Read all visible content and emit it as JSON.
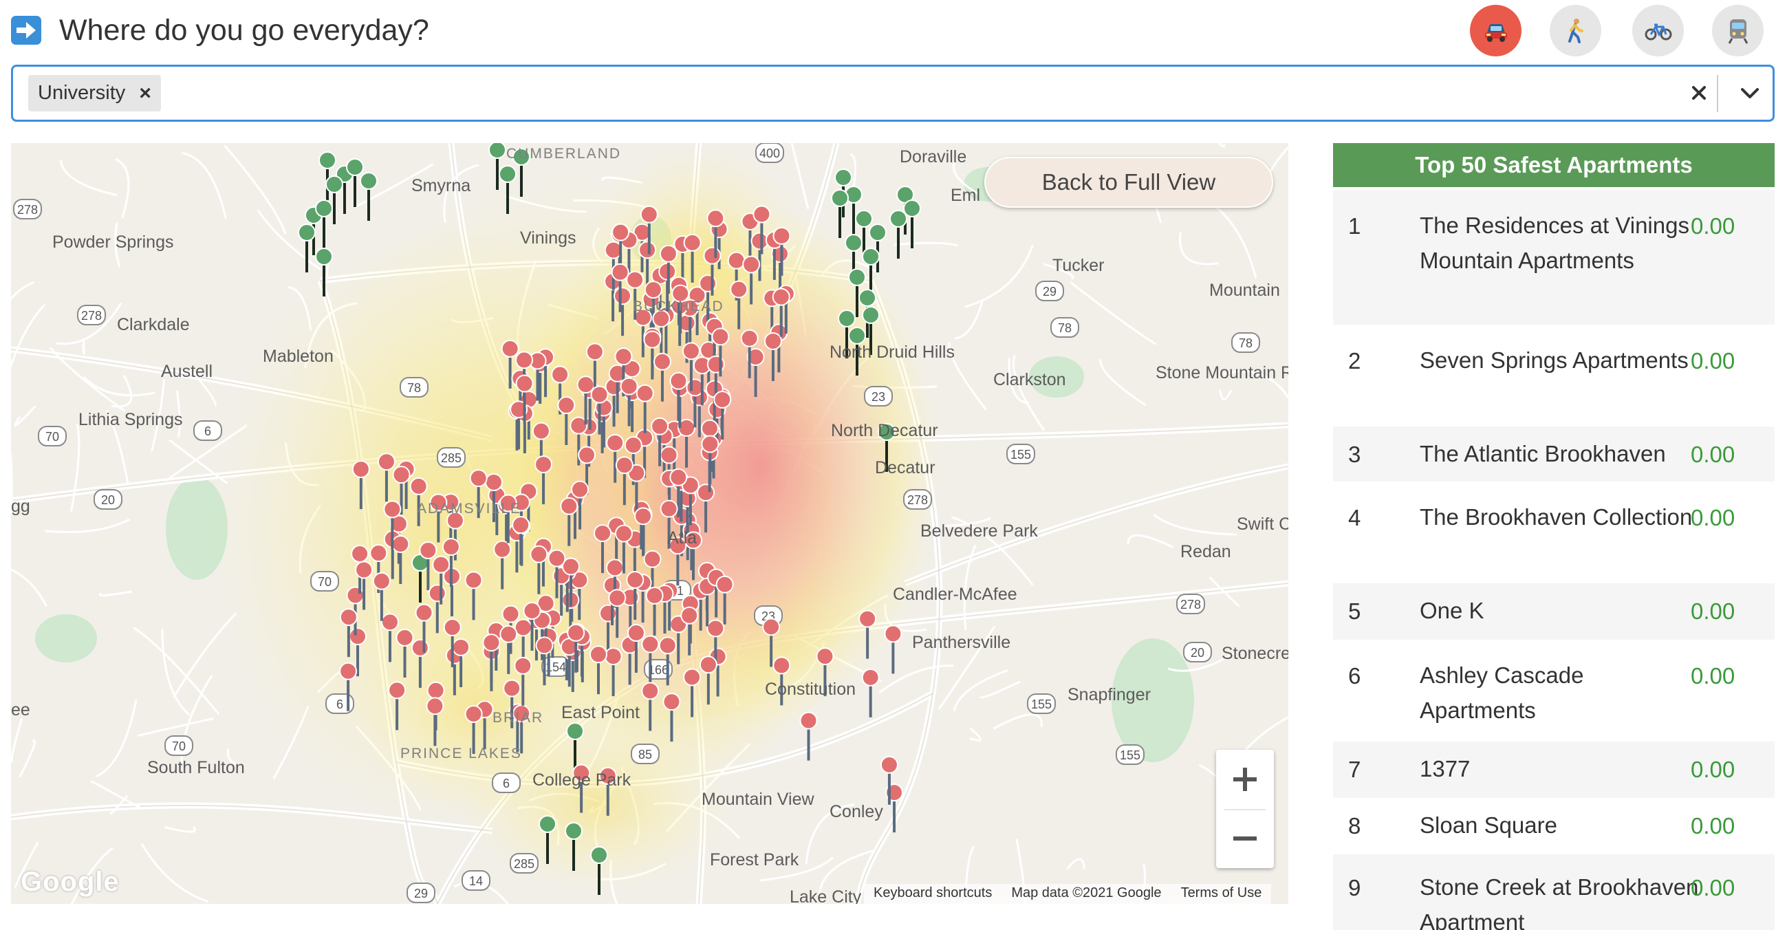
{
  "header": {
    "question": "Where do you go everyday?",
    "modes": [
      {
        "name": "car",
        "icon": "car-icon",
        "active": true
      },
      {
        "name": "walk",
        "icon": "walking-person-icon",
        "active": false
      },
      {
        "name": "bike",
        "icon": "bicycle-icon",
        "active": false
      },
      {
        "name": "transit",
        "icon": "train-icon",
        "active": false
      }
    ]
  },
  "select": {
    "selected": [
      "University"
    ]
  },
  "map": {
    "back_button": "Back to Full View",
    "google": "Google",
    "attribution": {
      "shortcuts": "Keyboard shortcuts",
      "data": "Map data ©2021 Google",
      "terms": "Terms of Use"
    },
    "labels": [
      "Smyrna",
      "Doraville",
      "Powder Springs",
      "Vinings",
      "Tucker",
      "Mountain",
      "Clarkdale",
      "Mableton",
      "Austell",
      "North Druid Hills",
      "Clarkston",
      "Stone Mountain",
      "Lithia Springs",
      "North Decatur",
      "Decatur",
      "Belvedere Park",
      "Swift C",
      "Redan",
      "Candler-McAfee",
      "Panthersville",
      "Stonecre",
      "Snapfinger",
      "Constitution",
      "East Point",
      "South Fulton",
      "College Park",
      "Mountain View",
      "Conley",
      "Forest Park",
      "Lake City",
      "Ro",
      "ee",
      "gg",
      "Eml",
      "CUMBERLAND",
      "BUCKHEAD",
      "ADAMSVILLE",
      "BRIAR",
      "PRINCE LAKES",
      "Atla"
    ],
    "highway_shields": [
      "278",
      "400",
      "29",
      "78",
      "278",
      "78",
      "23",
      "6",
      "78",
      "70",
      "285",
      "155",
      "278",
      "20",
      "70",
      "41",
      "23",
      "278",
      "154",
      "166",
      "6",
      "20",
      "155",
      "85",
      "70",
      "155",
      "6",
      "14",
      "285",
      "29"
    ]
  },
  "panel": {
    "title": "Top 50 Safest Apartments",
    "rows": [
      {
        "rank": "1",
        "name": "The Residences at Vinings Mountain Apartments",
        "score": "0.00"
      },
      {
        "rank": "2",
        "name": "Seven Springs Apartments",
        "score": "0.00"
      },
      {
        "rank": "3",
        "name": "The Atlantic Brookhaven",
        "score": "0.00"
      },
      {
        "rank": "4",
        "name": "The Brookhaven Collection",
        "score": "0.00"
      },
      {
        "rank": "5",
        "name": "One K",
        "score": "0.00"
      },
      {
        "rank": "6",
        "name": "Ashley Cascade Apartments",
        "score": "0.00"
      },
      {
        "rank": "7",
        "name": "1377",
        "score": "0.00"
      },
      {
        "rank": "8",
        "name": "Sloan Square",
        "score": "0.00"
      },
      {
        "rank": "9",
        "name": "Stone Creek at Brookhaven Apartment",
        "score": "0.00"
      }
    ]
  },
  "colors": {
    "accent_blue": "#3c8fde",
    "active_mode": "#ea5a4a",
    "panel_header": "#5a9a57",
    "score_green": "#3a9a3a",
    "pin_red": "#e26f6f",
    "pin_green": "#5aa36a"
  }
}
